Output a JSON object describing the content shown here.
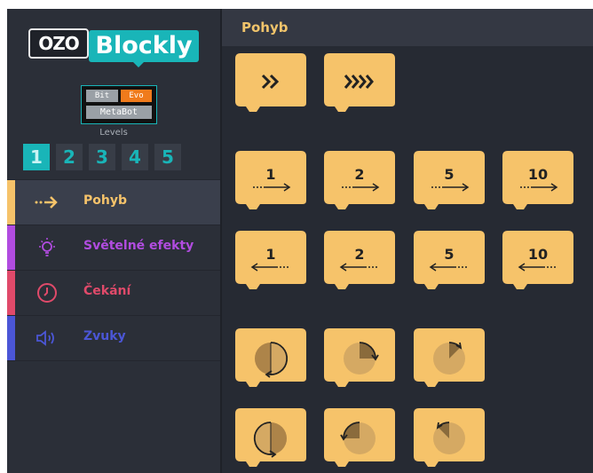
{
  "header": {
    "title": "Pohyb"
  },
  "logo": {
    "ozo": "OZO",
    "blockly": "Blockly"
  },
  "robots": {
    "bit": "Bit",
    "evo": "Evo",
    "metabot": "MetaBot",
    "levels_label": "Levels"
  },
  "levels": [
    "1",
    "2",
    "3",
    "4",
    "5"
  ],
  "active_level": "1",
  "categories": [
    {
      "label": "Pohyb",
      "color": "#f6c36a",
      "icon": "arrow-right-icon",
      "active": true
    },
    {
      "label": "Světelné efekty",
      "color": "#b14ce0",
      "icon": "lightbulb-icon",
      "active": false
    },
    {
      "label": "Čekání",
      "color": "#e04a6a",
      "icon": "clock-icon",
      "active": false
    },
    {
      "label": "Zvuky",
      "color": "#4b56d6",
      "icon": "speaker-icon",
      "active": false
    }
  ],
  "blocks": {
    "speed": [
      "fast-forward-icon",
      "very-fast-forward-icon"
    ],
    "forward": [
      "1",
      "2",
      "5",
      "10"
    ],
    "backward": [
      "1",
      "2",
      "5",
      "10"
    ],
    "turn_right": [
      "rotate-full-cw-icon",
      "rotate-quarter-cw-icon",
      "rotate-eighth-cw-icon"
    ],
    "turn_left": [
      "rotate-full-ccw-icon",
      "rotate-quarter-ccw-icon",
      "rotate-eighth-ccw-icon"
    ]
  },
  "colors": {
    "accent": "#19b5b8",
    "block": "#f6c36a",
    "header_text": "#f1c46b"
  }
}
